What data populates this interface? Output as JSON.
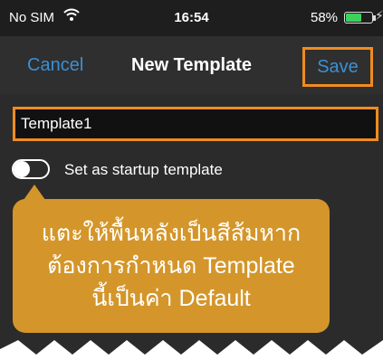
{
  "status_bar": {
    "carrier": "No SIM",
    "time": "16:54",
    "battery_text": "58%",
    "battery_level": 0.58,
    "wifi_icon": "wifi-icon",
    "charging_icon": "charging-icon"
  },
  "nav": {
    "cancel_label": "Cancel",
    "title": "New Template",
    "save_label": "Save"
  },
  "form": {
    "template_name": "Template1",
    "startup_label": "Set as startup template",
    "startup_enabled": false
  },
  "tooltip": {
    "line1": "แตะให้พื้นหลังเป็นสีส้มหาก",
    "line2": "ต้องการกำหนด Template",
    "line3": "นี้เป็นค่า Default"
  },
  "colors": {
    "highlight": "#f08c1e",
    "link": "#3c8fd6",
    "tooltip_bg": "#d4962a",
    "battery_green": "#3dd25c"
  }
}
